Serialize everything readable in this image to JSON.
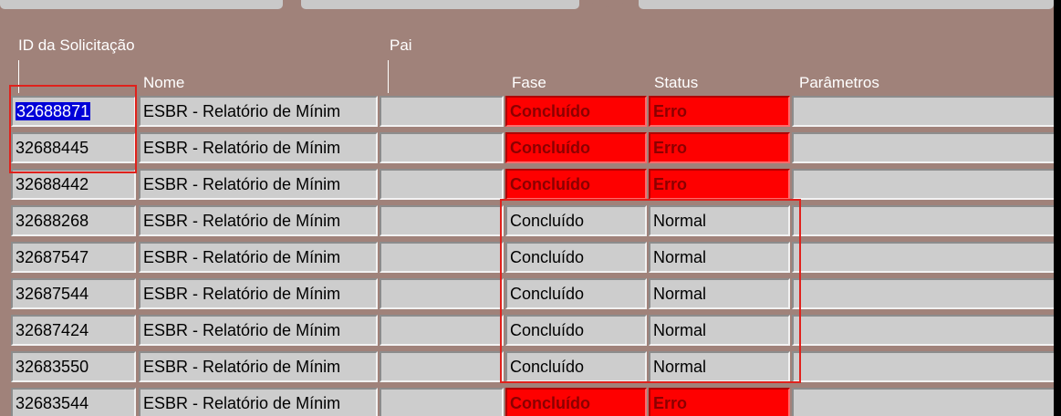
{
  "columns": {
    "id": "ID da Solicitação",
    "pai": "Pai",
    "nome": "Nome",
    "fase": "Fase",
    "status": "Status",
    "parametros": "Parâmetros"
  },
  "rows": [
    {
      "id": "32688871",
      "nome": "ESBR - Relatório de Mínim",
      "pai": "",
      "fase": "Concluído",
      "status": "Erro",
      "error": true,
      "selected": true
    },
    {
      "id": "32688445",
      "nome": "ESBR - Relatório de Mínim",
      "pai": "",
      "fase": "Concluído",
      "status": "Erro",
      "error": true
    },
    {
      "id": "32688442",
      "nome": "ESBR - Relatório de Mínim",
      "pai": "",
      "fase": "Concluído",
      "status": "Erro",
      "error": true
    },
    {
      "id": "32688268",
      "nome": "ESBR - Relatório de Mínim",
      "pai": "",
      "fase": "Concluído",
      "status": "Normal",
      "error": false
    },
    {
      "id": "32687547",
      "nome": "ESBR - Relatório de Mínim",
      "pai": "",
      "fase": "Concluído",
      "status": "Normal",
      "error": false
    },
    {
      "id": "32687544",
      "nome": "ESBR - Relatório de Mínim",
      "pai": "",
      "fase": "Concluído",
      "status": "Normal",
      "error": false
    },
    {
      "id": "32687424",
      "nome": "ESBR - Relatório de Mínim",
      "pai": "",
      "fase": "Concluído",
      "status": "Normal",
      "error": false
    },
    {
      "id": "32683550",
      "nome": "ESBR - Relatório de Mínim",
      "pai": "",
      "fase": "Concluído",
      "status": "Normal",
      "error": false
    },
    {
      "id": "32683544",
      "nome": "ESBR - Relatório de Mínim",
      "pai": "",
      "fase": "Concluído",
      "status": "Erro",
      "error": true
    }
  ],
  "colors": {
    "header_bg": "#a0827a",
    "cell_bg": "#cdcdcd",
    "error_bg": "#fe0000",
    "selection_bg": "#0000d8",
    "highlight_box": "#e0211c"
  }
}
